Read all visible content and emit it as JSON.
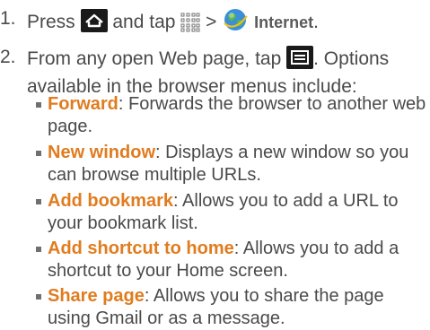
{
  "step1": {
    "number": "1.",
    "press": "Press",
    "and_tap": "and tap",
    "arrow": ">",
    "internet": "Internet",
    "period": ".",
    "icons": [
      "home-key-icon",
      "apps-grid-icon",
      "internet-globe-icon"
    ]
  },
  "step2": {
    "number": "2.",
    "line1_before": "From any open Web page, tap",
    "line1_after": ". Options",
    "line2": "available in the browser menus include:",
    "icons": [
      "menu-key-icon"
    ]
  },
  "bullets": [
    {
      "term": "Forward",
      "desc": ": Forwards the browser to another web page."
    },
    {
      "term": "New window",
      "desc": ": Displays a new window so you can browse multiple URLs."
    },
    {
      "term": "Add bookmark",
      "desc": ": Allows you to add a URL to your bookmark list."
    },
    {
      "term": "Add shortcut to home",
      "desc": ": Allows you to add a shortcut to your Home screen."
    },
    {
      "term": "Share page",
      "desc": ": Allows you to share the page using Gmail or as a message."
    }
  ],
  "colors": {
    "text": "#4a4a4a",
    "accent": "#e07c1e",
    "icon_bg": "#1a1a1a"
  }
}
